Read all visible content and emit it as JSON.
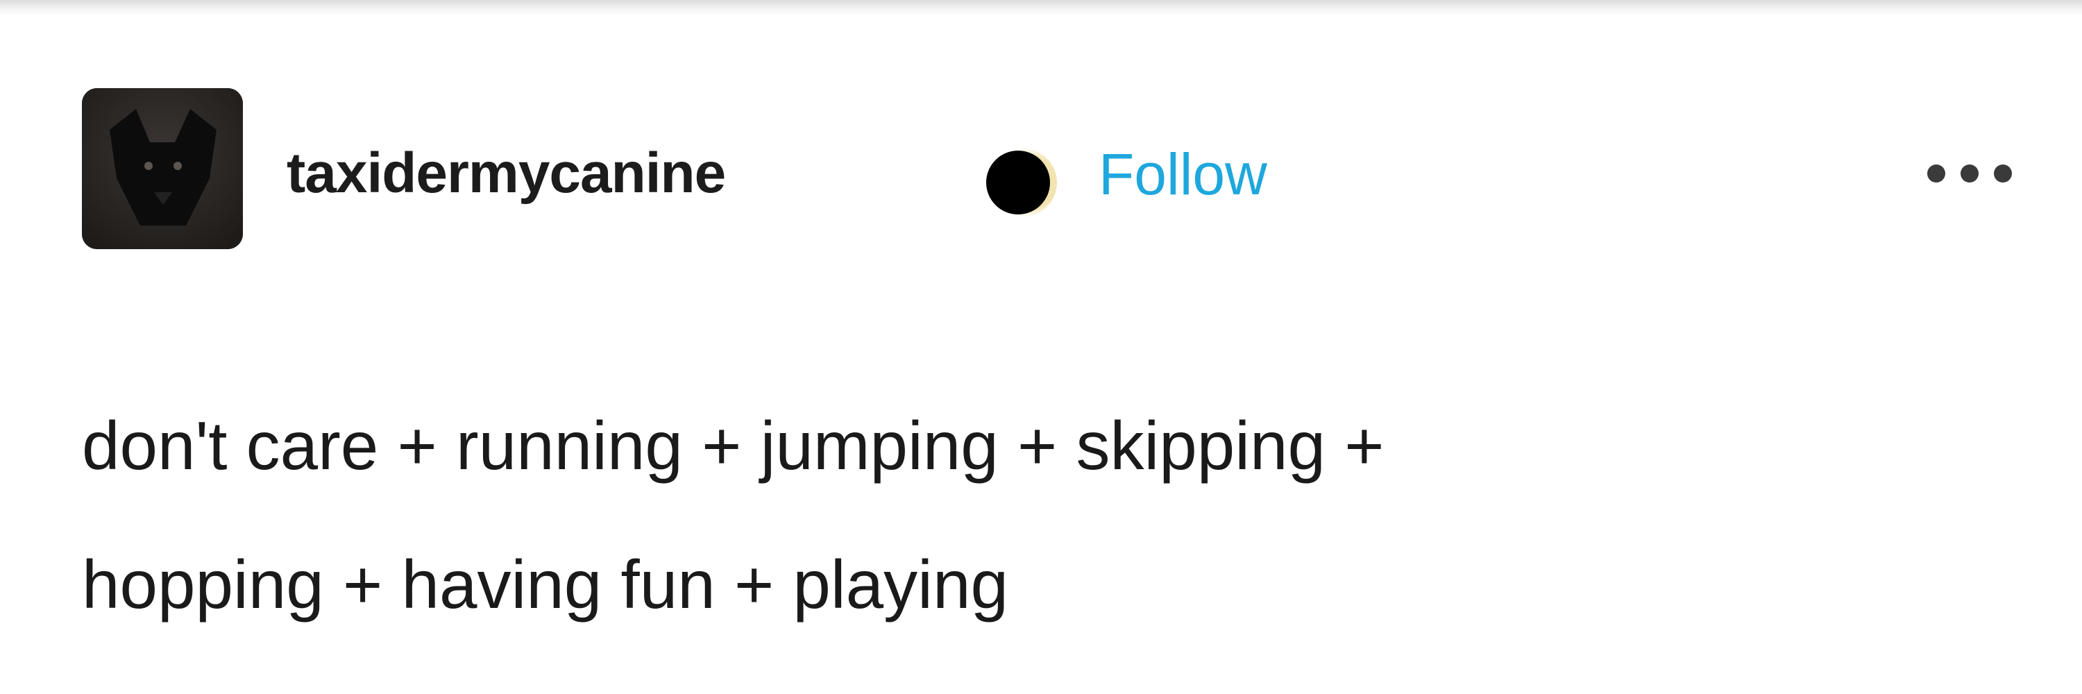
{
  "post": {
    "author": {
      "username": "taxidermycanine",
      "avatar_icon": "black-wolf-avatar",
      "badge_icon": "eclipse-moon-icon"
    },
    "follow_label": "Follow",
    "menu_icon": "more-options-icon",
    "body_text": "don't care + running + jumping + skipping +\nhopping + having fun + playing"
  },
  "colors": {
    "follow_link": "#1ea7dd",
    "text": "#1a1a1a",
    "background": "#ffffff"
  }
}
